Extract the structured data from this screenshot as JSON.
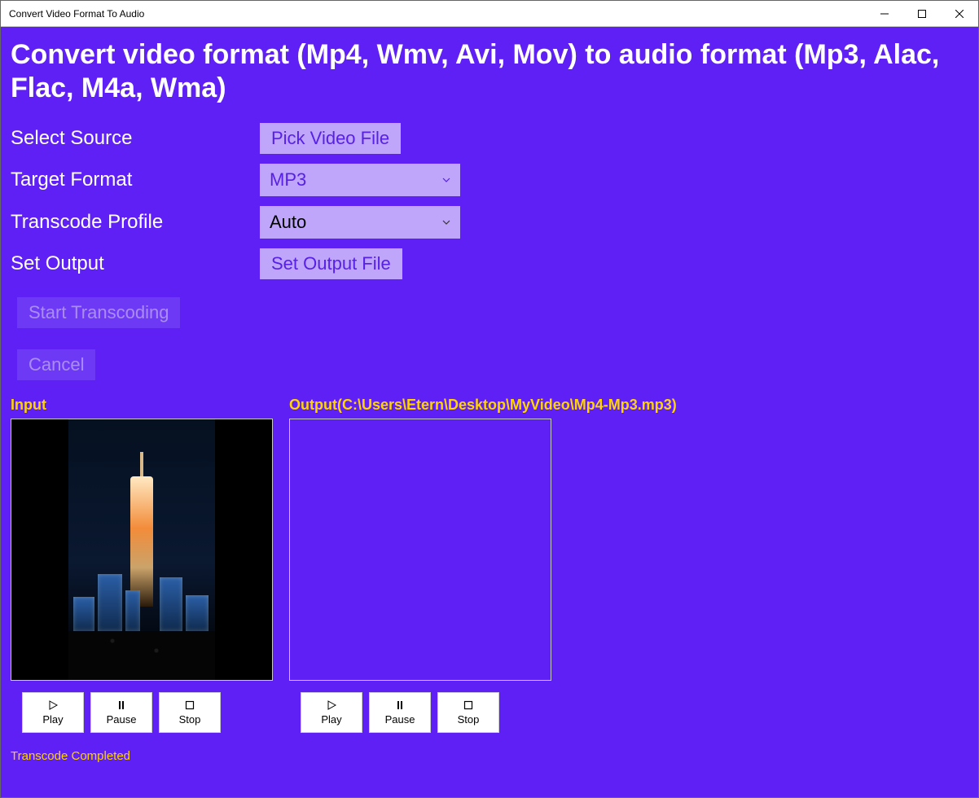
{
  "window": {
    "title": "Convert Video Format To Audio"
  },
  "heading": "Convert video format (Mp4, Wmv, Avi, Mov) to audio format (Mp3, Alac, Flac, M4a, Wma)",
  "labels": {
    "select_source": "Select Source",
    "target_format": "Target Format",
    "transcode_profile": "Transcode Profile",
    "set_output": "Set Output"
  },
  "buttons": {
    "pick_video": "Pick Video File",
    "set_output_file": "Set Output File",
    "start_transcoding": "Start Transcoding",
    "cancel": "Cancel"
  },
  "target_format": {
    "value": "MP3"
  },
  "transcode_profile": {
    "value": "Auto"
  },
  "preview": {
    "input_label": "Input",
    "output_label": "Output(C:\\Users\\Etern\\Desktop\\MyVideo\\Mp4-Mp3.mp3)"
  },
  "media": {
    "play": "Play",
    "pause": "Pause",
    "stop": "Stop"
  },
  "status": "Transcode Completed"
}
